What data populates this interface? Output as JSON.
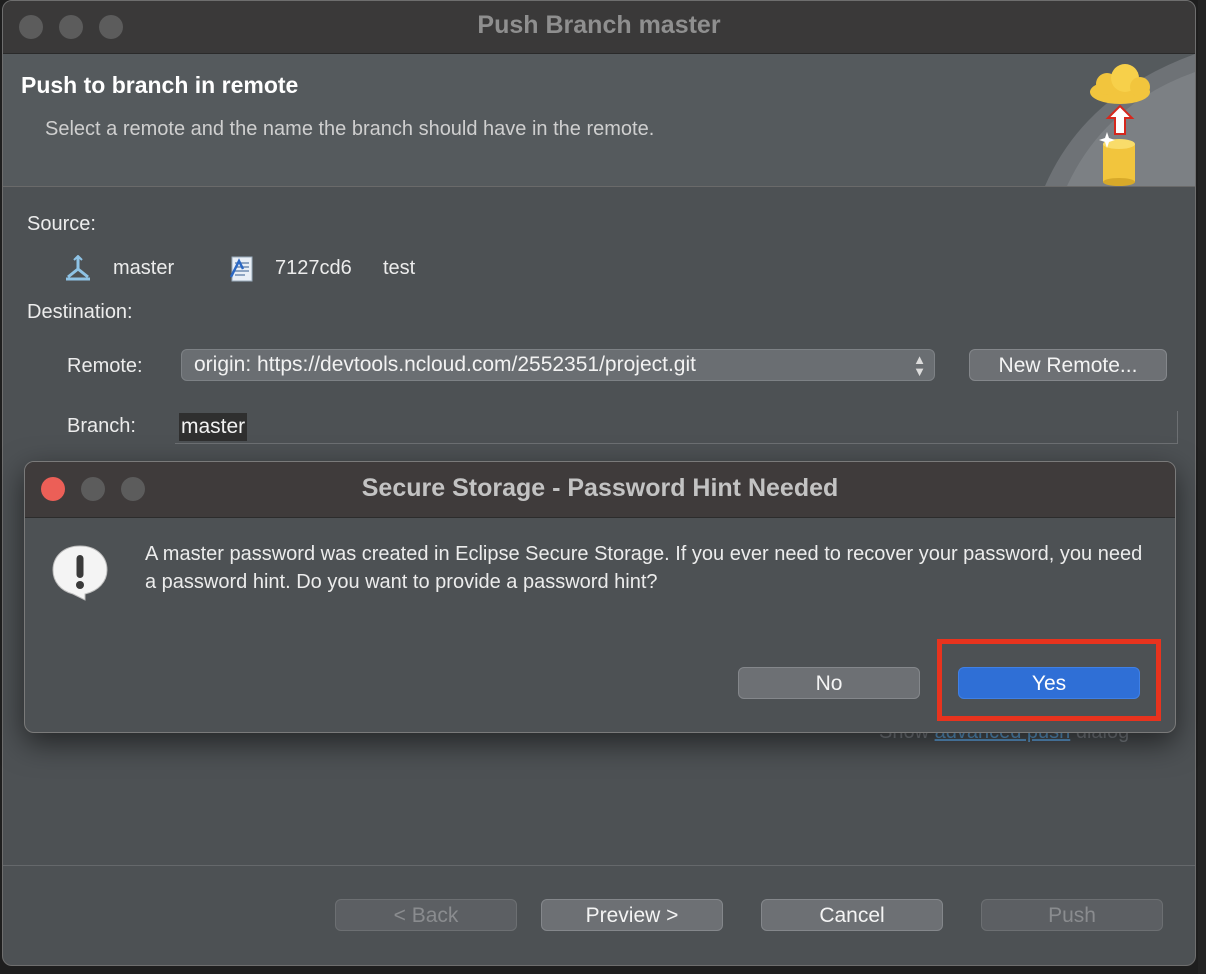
{
  "window": {
    "title": "Push Branch master"
  },
  "header": {
    "title": "Push to branch in remote",
    "description": "Select a remote and the name the branch should have in the remote."
  },
  "source": {
    "label": "Source:",
    "branch": "master",
    "commit_id": "7127cd6",
    "commit_message": "test"
  },
  "destination": {
    "label": "Destination:",
    "remote_label": "Remote:",
    "remote_value": "origin: https://devtools.ncloud.com/2552351/project.git",
    "new_remote_button": "New Remote...",
    "branch_label": "Branch:",
    "branch_value": "master"
  },
  "advanced": {
    "prefix": "Show",
    "link": "advanced push",
    "suffix": "dialog"
  },
  "buttons": {
    "back": "< Back",
    "preview": "Preview >",
    "cancel": "Cancel",
    "push": "Push"
  },
  "modal": {
    "title": "Secure Storage - Password Hint Needed",
    "message": "A master password was created in Eclipse Secure Storage. If you ever need to recover your password, you need a password hint. Do you want to provide a password hint?",
    "no_button": "No",
    "yes_button": "Yes"
  },
  "colors": {
    "highlight": "#e8331e",
    "primary_button": "#2f6fd6",
    "close_light": "#ec5f57"
  }
}
